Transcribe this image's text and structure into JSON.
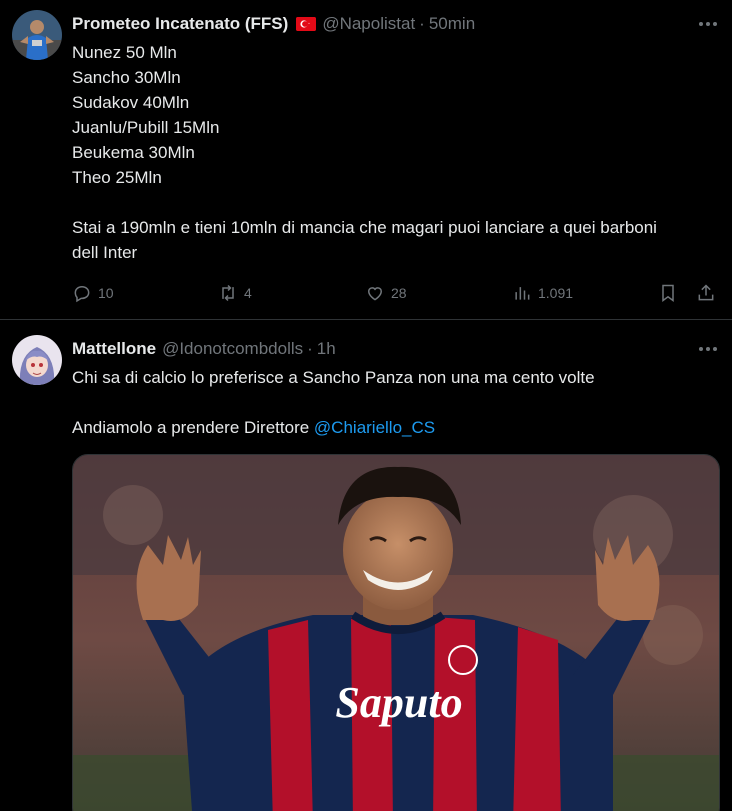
{
  "tweets": [
    {
      "author_name": "Prometeo Incatenato (FFS)",
      "handle": "@Napolistat",
      "separator": "·",
      "time": "50min",
      "lines": [
        "Nunez 50 Mln",
        "Sancho 30Mln",
        "Sudakov 40Mln",
        "Juanlu/Pubill 15Mln",
        "Beukema 30Mln",
        "Theo 25Mln",
        "",
        "Stai a 190mln e tieni 10mln di mancia che magari puoi lanciare a quei barboni",
        "dell Inter"
      ],
      "replies": "10",
      "retweets": "4",
      "likes": "28",
      "views": "1.091"
    },
    {
      "author_name": "Mattellone",
      "handle": "@Idonotcombdolls",
      "separator": "·",
      "time": "1h",
      "line1": "Chi sa di calcio lo preferisce a Sancho Panza non una ma cento volte",
      "line2_prefix": "Andiamolo a prendere Direttore ",
      "mention": "@Chiariello_CS",
      "jersey_text": "Saputo"
    }
  ],
  "colors": {
    "background": "#000000",
    "text": "#e7e9ea",
    "muted": "#71767b",
    "link": "#1d9bf0",
    "divider": "#2f3336",
    "jersey_red": "#b3102a",
    "jersey_blue": "#14264f"
  }
}
